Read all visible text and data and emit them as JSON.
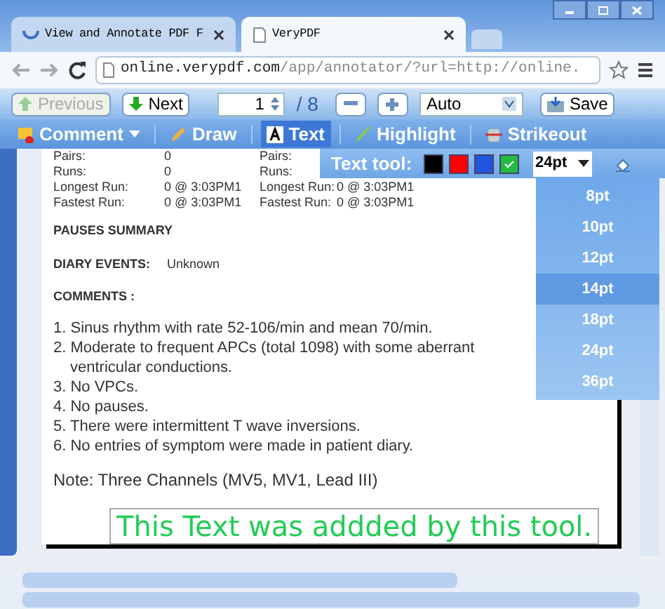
{
  "tabs": [
    {
      "label": "View and Annotate PDF F",
      "selected": false
    },
    {
      "label": "VeryPDF",
      "selected": true
    }
  ],
  "address": {
    "host": "online.verypdf.com",
    "path": "/app/annotator/?url=http://online."
  },
  "nav": {
    "previous": {
      "label": "Previous",
      "disabled": true
    },
    "next": {
      "label": "Next",
      "disabled": false
    },
    "page": "1",
    "total": "/ 8",
    "zoom": "Auto",
    "save": "Save"
  },
  "tools": [
    {
      "label": "Comment",
      "kind": "comment",
      "selected": false
    },
    {
      "label": "Draw",
      "kind": "draw",
      "selected": false
    },
    {
      "label": "Text",
      "kind": "text",
      "selected": true
    },
    {
      "label": "Highlight",
      "kind": "highlight",
      "selected": false
    },
    {
      "label": "Strikeout",
      "kind": "strikeout",
      "selected": false
    }
  ],
  "text_tool": {
    "label": "Text tool:",
    "colors": [
      {
        "color": "#000000",
        "selected": false
      },
      {
        "color": "#ff0000",
        "selected": false
      },
      {
        "color": "#2255dd",
        "selected": false
      },
      {
        "color": "#22bb44",
        "selected": true
      }
    ],
    "size": "24pt",
    "sizes": [
      {
        "label": "8pt",
        "selected": false
      },
      {
        "label": "10pt",
        "selected": false
      },
      {
        "label": "12pt",
        "selected": false
      },
      {
        "label": "14pt",
        "selected": true
      },
      {
        "label": "18pt",
        "selected": false
      },
      {
        "label": "24pt",
        "selected": false
      },
      {
        "label": "36pt",
        "selected": false
      }
    ]
  },
  "document": {
    "stats": [
      [
        "Pairs:",
        "0",
        "Pairs:"
      ],
      [
        "Runs:",
        "0",
        "Runs:"
      ],
      [
        "Longest Run:",
        "0 @ 3:03PM1",
        "Longest Run:",
        "0 @ 3:03PM1"
      ],
      [
        "Fastest Run:",
        "0 @ 3:03PM1",
        "Fastest Run:",
        "0 @ 3:03PM1"
      ]
    ],
    "pauses": "PAUSES SUMMARY",
    "diary_label": "DIARY EVENTS:",
    "diary_value": "Unknown",
    "comments_heading": "COMMENTS :",
    "comments": [
      "1. Sinus rhythm with rate 52-106/min and mean 70/min.",
      "2. Moderate to frequent APCs (total 1098) with some aberrant ventricular conductions.",
      "3. No VPCs.",
      "4. No pauses.",
      "5. There were intermittent T wave inversions.",
      "6. No entries of symptom were made in patient diary."
    ],
    "note": "Note: Three Channels (MV5, MV1, Lead III)",
    "annotation": {
      "text": "This Text was addded by this tool.",
      "color": "#22cc55"
    }
  }
}
